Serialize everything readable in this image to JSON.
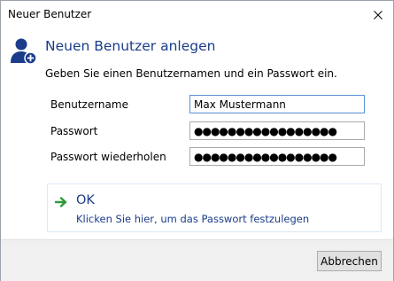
{
  "window": {
    "title": "Neuer Benutzer"
  },
  "header": {
    "heading": "Neuen Benutzer anlegen",
    "subtext": "Geben Sie einen Benutzernamen und ein Passwort ein."
  },
  "form": {
    "username_label": "Benutzername",
    "username_value": "Max Mustermann",
    "password_label": "Passwort",
    "password_value": "●●●●●●●●●●●●●●●●●",
    "password_repeat_label": "Passwort wiederholen",
    "password_repeat_value": "●●●●●●●●●●●●●●●●●"
  },
  "ok_action": {
    "title": "OK",
    "description": "Klicken Sie hier, um das Passwort festzulegen"
  },
  "footer": {
    "cancel_label": "Abbrechen"
  },
  "colors": {
    "accent": "#1a3c8a",
    "arrow": "#2e9a3a",
    "footer_bg": "#f0f0f0"
  },
  "icons": {
    "user_add": "user-add-icon",
    "close": "close-icon",
    "arrow": "arrow-right-icon"
  }
}
